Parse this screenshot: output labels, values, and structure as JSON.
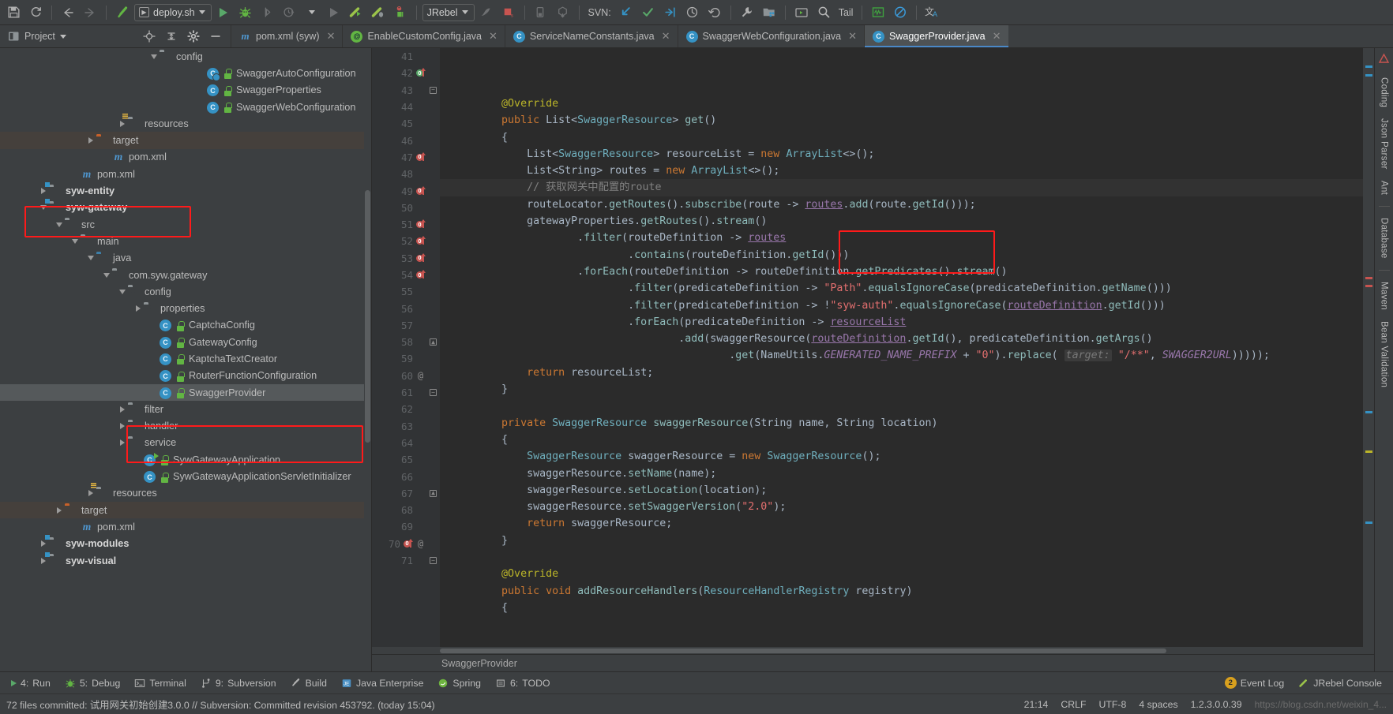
{
  "toolbar": {
    "run_config": "deploy.sh",
    "jrebel_label": "JRebel",
    "svn_label": "SVN:",
    "tail_label": "Tail",
    "buttons": [
      {
        "name": "save-all-button",
        "icon": "save-icon"
      },
      {
        "name": "sync-button",
        "icon": "refresh-icon"
      },
      {
        "name": "back-button",
        "icon": "arrow-left-icon"
      },
      {
        "name": "forward-button",
        "icon": "arrow-right-icon"
      },
      {
        "name": "build-project-button",
        "icon": "hammer-icon"
      },
      {
        "name": "run-button",
        "icon": "play-icon"
      },
      {
        "name": "debug-button",
        "icon": "bug-icon"
      },
      {
        "name": "run-with-coverage-button",
        "icon": "coverage-icon"
      },
      {
        "name": "profile-button",
        "icon": "profiler-icon"
      },
      {
        "name": "stop-button",
        "icon": "stop-icon"
      },
      {
        "name": "jrebel-run-button",
        "icon": "jrebel-run-icon"
      },
      {
        "name": "jrebel-debug-button",
        "icon": "jrebel-debug-icon"
      },
      {
        "name": "jrebel-profile-button",
        "icon": "jrebel-profile-icon"
      },
      {
        "name": "tomcat-button",
        "icon": "tomcat-icon"
      },
      {
        "name": "redeploy-button",
        "icon": "redeploy-icon"
      },
      {
        "name": "device-manager-button",
        "icon": "device-icon"
      },
      {
        "name": "sync-gradle-button",
        "icon": "package-down-icon"
      },
      {
        "name": "svn-update-button",
        "icon": "arrow-down-left-icon"
      },
      {
        "name": "svn-commit-button",
        "icon": "check-icon"
      },
      {
        "name": "svn-update-project-button",
        "icon": "arrow-into-icon"
      },
      {
        "name": "svn-history-button",
        "icon": "clock-icon"
      },
      {
        "name": "svn-revert-button",
        "icon": "undo-icon"
      },
      {
        "name": "settings-button",
        "icon": "wrench-icon"
      },
      {
        "name": "project-structure-button",
        "icon": "project-structure-icon"
      },
      {
        "name": "console-button",
        "icon": "terminal-icon"
      },
      {
        "name": "search-everywhere-button",
        "icon": "search-icon"
      },
      {
        "name": "tail-button",
        "icon": "tail-icon"
      },
      {
        "name": "activity-monitor-button",
        "icon": "activity-icon"
      },
      {
        "name": "no-entry-button",
        "icon": "block-icon"
      },
      {
        "name": "translate-button",
        "icon": "translate-icon"
      }
    ]
  },
  "project_panel": {
    "title": "Project",
    "tools": [
      {
        "name": "locate-button",
        "icon": "crosshair-icon"
      },
      {
        "name": "expand-collapse-button",
        "icon": "collapse-all-icon"
      },
      {
        "name": "settings-gear-button",
        "icon": "gear-icon"
      },
      {
        "name": "hide-button",
        "icon": "minus-icon"
      }
    ]
  },
  "editor_tabs": [
    {
      "label": "pom.xml (syw)",
      "icon": "maven-icon",
      "active": false
    },
    {
      "label": "EnableCustomConfig.java",
      "icon": "annotation-icon",
      "active": false
    },
    {
      "label": "ServiceNameConstants.java",
      "icon": "class-icon",
      "active": false
    },
    {
      "label": "SwaggerWebConfiguration.java",
      "icon": "class-icon",
      "active": false
    },
    {
      "label": "SwaggerProvider.java",
      "icon": "class-icon",
      "active": true
    }
  ],
  "tree": [
    {
      "label": "config",
      "indent": 9,
      "arrow": "down",
      "icon": "package-folder",
      "state": "normal"
    },
    {
      "label": "SwaggerAutoConfiguration",
      "indent": 12,
      "arrow": "none",
      "icon": "class-annotated",
      "lock": true,
      "state": "normal"
    },
    {
      "label": "SwaggerProperties",
      "indent": 12,
      "arrow": "none",
      "icon": "class",
      "lock": true,
      "state": "normal"
    },
    {
      "label": "SwaggerWebConfiguration",
      "indent": 12,
      "arrow": "none",
      "icon": "class",
      "lock": true,
      "state": "normal"
    },
    {
      "label": "resources",
      "indent": 7,
      "arrow": "right",
      "icon": "resources-folder",
      "state": "normal"
    },
    {
      "label": "target",
      "indent": 5,
      "arrow": "right",
      "icon": "orange-folder",
      "state": "highlight"
    },
    {
      "label": "pom.xml",
      "indent": 6,
      "arrow": "none",
      "icon": "maven",
      "state": "normal"
    },
    {
      "label": "pom.xml",
      "indent": 4,
      "arrow": "none",
      "icon": "maven",
      "state": "normal"
    },
    {
      "label": "syw-entity",
      "indent": 2,
      "arrow": "right",
      "icon": "module-folder",
      "bold": true,
      "state": "normal"
    },
    {
      "label": "syw-gateway",
      "indent": 2,
      "arrow": "down",
      "icon": "module-folder",
      "bold": true,
      "state": "normal"
    },
    {
      "label": "src",
      "indent": 3,
      "arrow": "down",
      "icon": "folder",
      "state": "normal"
    },
    {
      "label": "main",
      "indent": 4,
      "arrow": "down",
      "icon": "folder",
      "state": "normal"
    },
    {
      "label": "java",
      "indent": 5,
      "arrow": "down",
      "icon": "source-folder",
      "state": "normal"
    },
    {
      "label": "com.syw.gateway",
      "indent": 6,
      "arrow": "down",
      "icon": "package-folder",
      "state": "normal"
    },
    {
      "label": "config",
      "indent": 7,
      "arrow": "down",
      "icon": "package-folder",
      "state": "normal"
    },
    {
      "label": "properties",
      "indent": 8,
      "arrow": "right",
      "icon": "package-folder",
      "state": "normal"
    },
    {
      "label": "CaptchaConfig",
      "indent": 9,
      "arrow": "none",
      "icon": "class",
      "lock": true,
      "state": "normal"
    },
    {
      "label": "GatewayConfig",
      "indent": 9,
      "arrow": "none",
      "icon": "class",
      "lock": true,
      "state": "normal"
    },
    {
      "label": "KaptchaTextCreator",
      "indent": 9,
      "arrow": "none",
      "icon": "class",
      "lock": true,
      "state": "normal"
    },
    {
      "label": "RouterFunctionConfiguration",
      "indent": 9,
      "arrow": "none",
      "icon": "class",
      "lock": true,
      "state": "normal"
    },
    {
      "label": "SwaggerProvider",
      "indent": 9,
      "arrow": "none",
      "icon": "class",
      "lock": true,
      "state": "selected"
    },
    {
      "label": "filter",
      "indent": 7,
      "arrow": "right",
      "icon": "package-folder",
      "state": "normal"
    },
    {
      "label": "handler",
      "indent": 7,
      "arrow": "right",
      "icon": "package-folder",
      "state": "normal"
    },
    {
      "label": "service",
      "indent": 7,
      "arrow": "right",
      "icon": "package-folder",
      "state": "normal"
    },
    {
      "label": "SywGatewayApplication",
      "indent": 8,
      "arrow": "none",
      "icon": "class-runnable",
      "lock": true,
      "state": "normal"
    },
    {
      "label": "SywGatewayApplicationServletInitializer",
      "indent": 8,
      "arrow": "none",
      "icon": "class",
      "lock": true,
      "state": "normal"
    },
    {
      "label": "resources",
      "indent": 5,
      "arrow": "right",
      "icon": "resources-folder",
      "state": "normal"
    },
    {
      "label": "target",
      "indent": 3,
      "arrow": "right",
      "icon": "orange-folder",
      "state": "highlight"
    },
    {
      "label": "pom.xml",
      "indent": 4,
      "arrow": "none",
      "icon": "maven",
      "state": "normal"
    },
    {
      "label": "syw-modules",
      "indent": 2,
      "arrow": "right",
      "icon": "module-folder",
      "bold": true,
      "state": "normal"
    },
    {
      "label": "syw-visual",
      "indent": 2,
      "arrow": "right",
      "icon": "module-folder",
      "bold": true,
      "state": "normal"
    }
  ],
  "code": {
    "first_line_number": 41,
    "lines": [
      {
        "n": 41,
        "gutter": "",
        "fold": "",
        "html": "        <span class='ann2'>@Override</span>"
      },
      {
        "n": 42,
        "gutter": "override-green",
        "fold": "",
        "html": "        <span class='kw'>public</span> <span class='plain'>List&lt;</span><span class='type'>SwaggerResource</span><span class='plain'>&gt;</span> <span class='mth'>get</span><span class='plain'>()</span>"
      },
      {
        "n": 43,
        "gutter": "",
        "fold": "minus",
        "html": "        <span class='plain'>{</span>"
      },
      {
        "n": 44,
        "gutter": "",
        "fold": "",
        "html": "            <span class='plain'>List&lt;</span><span class='type'>SwaggerResource</span><span class='plain'>&gt; resourceList = </span><span class='kw'>new</span> <span class='type'>ArrayList</span><span class='plain'>&lt;&gt;();</span>"
      },
      {
        "n": 45,
        "gutter": "",
        "fold": "",
        "html": "            <span class='plain'>List&lt;String&gt; routes = </span><span class='kw'>new</span> <span class='type'>ArrayList</span><span class='plain'>&lt;&gt;();</span>"
      },
      {
        "n": 46,
        "gutter": "",
        "fold": "",
        "hl": true,
        "html": "            <span class='cmt'>// 获取网关中配置的route</span>"
      },
      {
        "n": 47,
        "gutter": "override-red",
        "fold": "",
        "html": "            <span class='plain'>routeLocator.</span><span class='mth'>getRoutes</span><span class='plain'>().</span><span class='mth'>subscribe</span><span class='plain'>(route -&gt; </span><span class='usf'>routes</span><span class='plain'>.</span><span class='mth'>add</span><span class='plain'>(route.</span><span class='mth'>getId</span><span class='plain'>()));</span>"
      },
      {
        "n": 48,
        "gutter": "",
        "fold": "",
        "html": "            <span class='plain'>gatewayProperties.</span><span class='mth'>getRoutes</span><span class='plain'>().</span><span class='mth'>stream</span><span class='plain'>()</span>"
      },
      {
        "n": 49,
        "gutter": "override-red",
        "fold": "",
        "html": "                    <span class='plain'>.</span><span class='mth'>filter</span><span class='plain'>(routeDefinition -&gt; </span><span class='usf'>routes</span>"
      },
      {
        "n": 50,
        "gutter": "",
        "fold": "",
        "html": "                            <span class='plain'>.</span><span class='mth'>contains</span><span class='plain'>(routeDefinition.</span><span class='mth'>getId</span><span class='plain'>()))</span>"
      },
      {
        "n": 51,
        "gutter": "override-red",
        "fold": "",
        "html": "                    <span class='plain'>.</span><span class='mth'>forEach</span><span class='plain'>(routeDefinition -&gt; routeDefinition.</span><span class='mth'>getPredicates</span><span class='plain'>().</span><span class='mth'>stream</span><span class='plain'>()</span>"
      },
      {
        "n": 52,
        "gutter": "override-red",
        "fold": "",
        "html": "                            <span class='plain'>.</span><span class='mth'>filter</span><span class='plain'>(predicateDefinition -&gt; </span><span class='str'>\"Path\"</span><span class='plain'>.</span><span class='mth'>equalsIgnoreCase</span><span class='plain'>(predicateDefinition.</span><span class='mth'>getName</span><span class='plain'>()))</span>"
      },
      {
        "n": 53,
        "gutter": "override-red",
        "fold": "",
        "html": "                            <span class='plain'>.</span><span class='mth'>filter</span><span class='plain'>(predicateDefinition -&gt; !</span><span class='str'>\"syw-auth\"</span><span class='plain'>.</span><span class='mth'>equalsIgnoreCase</span><span class='plain'>(</span><span class='usf'>routeDefinition</span><span class='plain'>.</span><span class='mth'>getId</span><span class='plain'>()))</span>"
      },
      {
        "n": 54,
        "gutter": "override-red",
        "fold": "",
        "html": "                            <span class='plain'>.</span><span class='mth'>forEach</span><span class='plain'>(predicateDefinition -&gt; </span><span class='usf'>resourceList</span>"
      },
      {
        "n": 55,
        "gutter": "",
        "fold": "",
        "html": "                                    <span class='plain'>.</span><span class='mth'>add</span><span class='plain'>(swaggerResource(</span><span class='usf'>routeDefinition</span><span class='plain'>.</span><span class='mth'>getId</span><span class='plain'>(), predicateDefinition.</span><span class='mth'>getArgs</span><span class='plain'>()</span>"
      },
      {
        "n": 56,
        "gutter": "",
        "fold": "",
        "html": "                                            <span class='plain'>.</span><span class='mth'>get</span><span class='plain'>(NameUtils.</span><span class='constu'>GENERATED_NAME_PREFIX</span><span class='plain'> + </span><span class='str'>\"0\"</span><span class='plain'>).</span><span class='mth'>replace</span><span class='plain'>( </span><span class='hint'>target:</span><span class='plain'> </span><span class='str'>\"/**\"</span><span class='plain'>, </span><span class='constu'>SWAGGER2URL</span><span class='plain'>)))));</span>"
      },
      {
        "n": 57,
        "gutter": "",
        "fold": "",
        "html": "            <span class='kw'>return</span> <span class='plain'>resourceList;</span>"
      },
      {
        "n": 58,
        "gutter": "",
        "fold": "up",
        "html": "        <span class='plain'>}</span>"
      },
      {
        "n": 59,
        "gutter": "",
        "fold": "",
        "html": ""
      },
      {
        "n": 60,
        "gutter": "at",
        "fold": "",
        "html": "        <span class='kw'>private</span> <span class='type'>SwaggerResource</span> <span class='mth'>swaggerResource</span><span class='plain'>(String name, String location)</span>"
      },
      {
        "n": 61,
        "gutter": "",
        "fold": "minus",
        "html": "        <span class='plain'>{</span>"
      },
      {
        "n": 62,
        "gutter": "",
        "fold": "",
        "html": "            <span class='type'>SwaggerResource</span> <span class='plain'>swaggerResource = </span><span class='kw'>new</span> <span class='type'>SwaggerResource</span><span class='plain'>();</span>"
      },
      {
        "n": 63,
        "gutter": "",
        "fold": "",
        "html": "            <span class='plain'>swaggerResource.</span><span class='mth'>setName</span><span class='plain'>(name);</span>"
      },
      {
        "n": 64,
        "gutter": "",
        "fold": "",
        "html": "            <span class='plain'>swaggerResource.</span><span class='mth'>setLocation</span><span class='plain'>(location);</span>"
      },
      {
        "n": 65,
        "gutter": "",
        "fold": "",
        "html": "            <span class='plain'>swaggerResource.</span><span class='mth'>setSwaggerVersion</span><span class='plain'>(</span><span class='str'>\"2.0\"</span><span class='plain'>);</span>"
      },
      {
        "n": 66,
        "gutter": "",
        "fold": "",
        "html": "            <span class='kw'>return</span> <span class='plain'>swaggerResource;</span>"
      },
      {
        "n": 67,
        "gutter": "",
        "fold": "up",
        "html": "        <span class='plain'>}</span>"
      },
      {
        "n": 68,
        "gutter": "",
        "fold": "",
        "html": ""
      },
      {
        "n": 69,
        "gutter": "",
        "fold": "",
        "html": "        <span class='ann2'>@Override</span>"
      },
      {
        "n": 70,
        "gutter": "override-red-at",
        "fold": "",
        "html": "        <span class='kw'>public</span> <span class='kw'>void</span> <span class='mth'>addResourceHandlers</span><span class='plain'>(</span><span class='type'>ResourceHandlerRegistry</span><span class='plain'> registry)</span>"
      },
      {
        "n": 71,
        "gutter": "",
        "fold": "minus",
        "html": "        <span class='plain'>{</span>"
      }
    ]
  },
  "breadcrumb": "SwaggerProvider",
  "right_toolwindows": [
    "Coding",
    "Json Parser",
    "Ant",
    "Database",
    "Maven",
    "Bean Validation"
  ],
  "bottom_tool_windows": [
    {
      "num": "4:",
      "label": "Run",
      "icon": "play-icon"
    },
    {
      "num": "5:",
      "label": "Debug",
      "icon": "bug-icon"
    },
    {
      "num": "",
      "label": "Terminal",
      "icon": "terminal-icon"
    },
    {
      "num": "9:",
      "label": "Subversion",
      "icon": "branch-icon"
    },
    {
      "num": "",
      "label": "Build",
      "icon": "hammer-icon"
    },
    {
      "num": "",
      "label": "Java Enterprise",
      "icon": "java-ee-icon"
    },
    {
      "num": "",
      "label": "Spring",
      "icon": "spring-icon"
    },
    {
      "num": "6:",
      "label": "TODO",
      "icon": "todo-icon"
    }
  ],
  "bottom_right": [
    {
      "label": "Event Log",
      "badge": "2",
      "icon": "event-log-icon"
    },
    {
      "label": "JRebel Console",
      "icon": "jrebel-icon"
    }
  ],
  "statusbar": {
    "message": "72 files committed: 试用网关初始创建3.0.0 // Subversion: Committed revision 453792. (today 15:04)",
    "time": "21:14",
    "caret": "CRLF",
    "encoding": "UTF-8",
    "indent": "4 spaces",
    "git_branch": "1.2.3.0.0.39",
    "watermark": "https://blog.csdn.net/weixin_4..."
  },
  "colors": {
    "accent_blue": "#4a88c7",
    "class_icon": "#3592c4",
    "annotation_green": "#62b543",
    "red_annotation": "#ff1a1a",
    "editor_bg": "#2b2b2b",
    "panel_bg": "#3c3f41",
    "gutter_bg": "#313335",
    "selection": "#55595b"
  }
}
